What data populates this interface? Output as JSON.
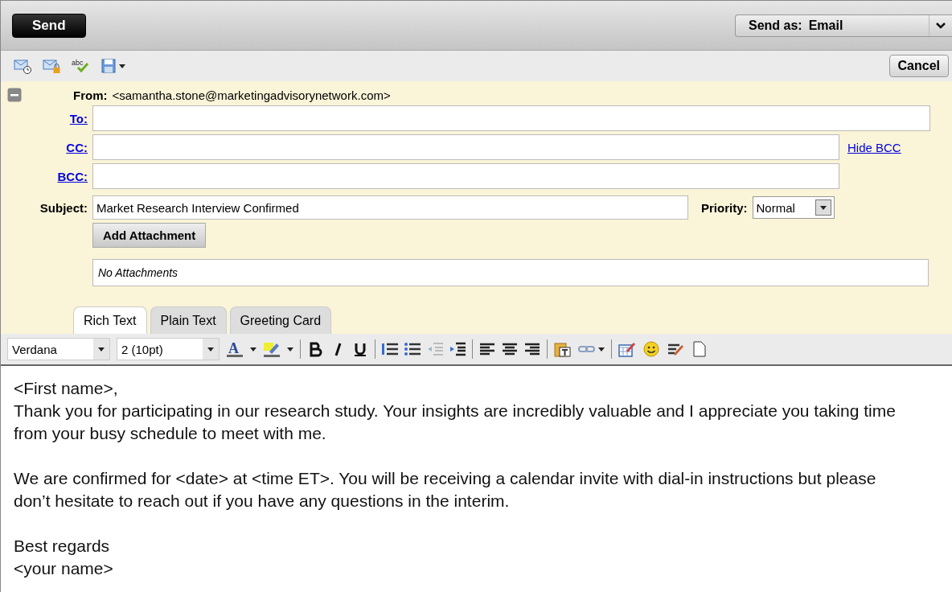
{
  "top_bar": {
    "send_button": "Send",
    "send_as": {
      "label": "Send as:",
      "value": "Email"
    }
  },
  "action_bar": {
    "spellcheck_glyph": "abc",
    "cancel_button": "Cancel"
  },
  "header": {
    "from_label": "From:",
    "from_value": "<samantha.stone@marketingadvisorynetwork.com>",
    "to_label": "To:",
    "cc_label": "CC:",
    "hide_bcc_link": "Hide BCC",
    "bcc_label": "BCC:",
    "subject_label": "Subject:",
    "subject_value": "Market Research Interview Confirmed",
    "priority_label": "Priority:",
    "priority_value": "Normal",
    "add_attachment_button": "Add Attachment",
    "attachments_text": "No Attachments"
  },
  "tabs": [
    {
      "label": "Rich Text",
      "selected": true
    },
    {
      "label": "Plain Text",
      "selected": false
    },
    {
      "label": "Greeting Card",
      "selected": false
    }
  ],
  "format_bar": {
    "font": "Verdana",
    "size": "2 (10pt)",
    "text_color_glyph": "A"
  },
  "body": [
    [
      "<First name>,",
      "Thank you for participating in our research study. Your insights are incredibly valuable and I appreciate you taking time",
      "from your busy schedule to meet with me."
    ],
    [
      "We are confirmed for <date> at <time ET>. You will be receiving a calendar invite with dial-in instructions but please",
      "don’t hesitate to reach out if you have any questions in the interim."
    ],
    [
      "Best regards",
      "<your name>"
    ]
  ]
}
